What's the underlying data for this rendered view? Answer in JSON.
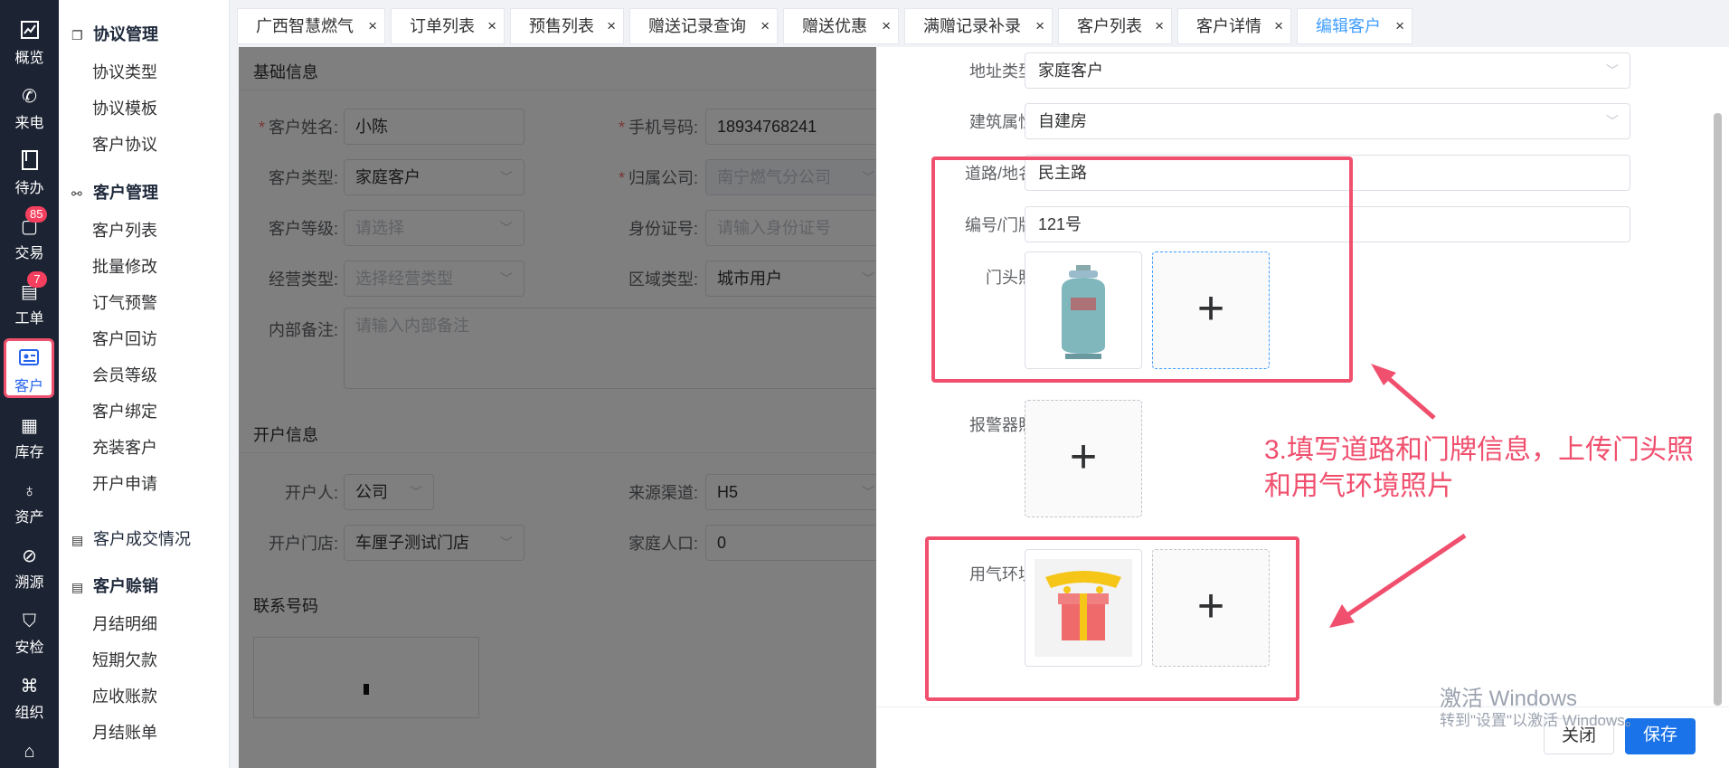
{
  "rail": {
    "items": [
      {
        "label": "概览",
        "icon": "chart-icon"
      },
      {
        "label": "来电",
        "icon": "phone-icon"
      },
      {
        "label": "待办",
        "icon": "todo-icon"
      },
      {
        "label": "交易",
        "icon": "trade-icon",
        "badge": "85"
      },
      {
        "label": "工单",
        "icon": "workorder-icon",
        "badge": "7"
      },
      {
        "label": "客户",
        "icon": "customer-card-icon"
      },
      {
        "label": "库存",
        "icon": "inventory-icon"
      },
      {
        "label": "资产",
        "icon": "asset-icon"
      },
      {
        "label": "溯源",
        "icon": "trace-icon"
      },
      {
        "label": "安检",
        "icon": "security-check-icon"
      },
      {
        "label": "组织",
        "icon": "org-icon"
      }
    ]
  },
  "menu": {
    "group1": {
      "title": "协议管理",
      "items": [
        "协议类型",
        "协议模板",
        "客户协议"
      ]
    },
    "group2": {
      "title": "客户管理",
      "items": [
        "客户列表",
        "批量修改",
        "订气预警",
        "客户回访",
        "会员等级",
        "客户绑定",
        "充装客户",
        "开户申请"
      ]
    },
    "single": "客户成交情况",
    "group3": {
      "title": "客户赊销",
      "items": [
        "月结明细",
        "短期欠款",
        "应收账款",
        "月结账单"
      ]
    }
  },
  "tabs": [
    "广西智慧燃气",
    "订单列表",
    "预售列表",
    "赠送记录查询",
    "赠送优惠",
    "满赠记录补录",
    "客户列表",
    "客户详情",
    "编辑客户"
  ],
  "form": {
    "basic_title": "基础信息",
    "name_label": "客户姓名:",
    "name_value": "小陈",
    "phone_label": "手机号码:",
    "phone_value": "18934768241",
    "type_label": "客户类型:",
    "type_value": "家庭客户",
    "company_label": "归属公司:",
    "company_value": "南宁燃气分公司",
    "level_label": "客户等级:",
    "level_placeholder": "请选择",
    "idcard_label": "身份证号:",
    "idcard_placeholder": "请输入身份证号",
    "biz_label": "经营类型:",
    "biz_placeholder": "选择经营类型",
    "area_label": "区域类型:",
    "area_value": "城市用户",
    "remark_label": "内部备注:",
    "remark_placeholder": "请输入内部备注",
    "open_title": "开户信息",
    "opener_label": "开户人:",
    "opener_value": "公司",
    "source_label": "来源渠道:",
    "source_value": "H5",
    "store_label": "开户门店:",
    "store_value": "车厘子测试门店",
    "family_label": "家庭人口:",
    "family_value": "0",
    "contact_title": "联系号码"
  },
  "drawer": {
    "addr_type_label": "地址类型:",
    "addr_type_value": "家庭客户",
    "building_label": "建筑属性:",
    "building_value": "自建房",
    "road_label": "道路/地名:",
    "road_value": "民主路",
    "number_label": "编号/门牌:",
    "number_value": "121号",
    "door_photo_label": "门头照:",
    "alarm_photo_label": "报警器照:",
    "env_photo_label": "用气环境:",
    "plus": "+"
  },
  "annotation": {
    "line1": "3.填写道路和门牌信息，上传门头照",
    "line2": "和用气环境照片",
    "color": "#f0506e"
  },
  "footer": {
    "close": "关闭",
    "save": "保存"
  },
  "watermark": {
    "line1": "激活 Windows",
    "line2": "转到\"设置\"以激活 Windows。"
  },
  "colors": {
    "rail_bg": "#1c2433",
    "primary": "#1a73e8",
    "highlight": "#f0506e"
  }
}
